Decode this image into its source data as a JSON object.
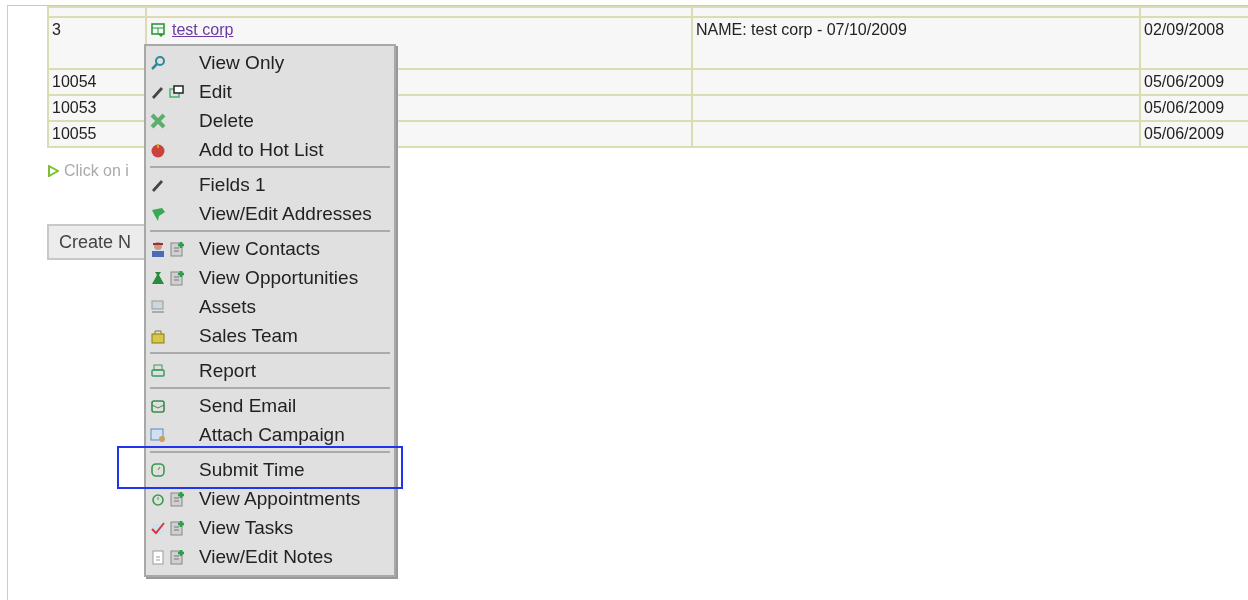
{
  "table": {
    "rows": [
      {
        "column_1": "3",
        "column_2": {
          "link": "test corp"
        },
        "column_3": "NAME: test corp - 07/10/2009",
        "column_4": "02/09/2008"
      },
      {
        "column_1": "10054",
        "column_4": "05/06/2009"
      },
      {
        "column_1": "10053",
        "column_4": "05/06/2009"
      },
      {
        "column_1": "10055",
        "column_4": "05/06/2009"
      }
    ]
  },
  "hint": "Click on i",
  "create_button": "Create N",
  "context_menu": {
    "groups": [
      [
        {
          "label": "View Only",
          "highlighted": false
        },
        {
          "label": "Edit",
          "highlighted": false
        },
        {
          "label": "Delete",
          "highlighted": false
        },
        {
          "label": "Add to Hot List",
          "highlighted": false
        }
      ],
      [
        {
          "label": "Fields 1",
          "highlighted": false
        },
        {
          "label": "View/Edit Addresses",
          "highlighted": false
        }
      ],
      [
        {
          "label": "View Contacts",
          "highlighted": false
        },
        {
          "label": "View Opportunities",
          "highlighted": false
        },
        {
          "label": "Assets",
          "highlighted": false
        },
        {
          "label": "Sales Team",
          "highlighted": false
        }
      ],
      [
        {
          "label": "Report",
          "highlighted": false
        }
      ],
      [
        {
          "label": "Send Email",
          "highlighted": false
        },
        {
          "label": "Attach Campaign",
          "highlighted": false
        }
      ],
      [
        {
          "label": "Submit Time",
          "highlighted": true
        },
        {
          "label": "View Appointments",
          "highlighted": false
        },
        {
          "label": "View Tasks",
          "highlighted": false
        },
        {
          "label": "View/Edit Notes",
          "highlighted": false
        }
      ]
    ]
  }
}
